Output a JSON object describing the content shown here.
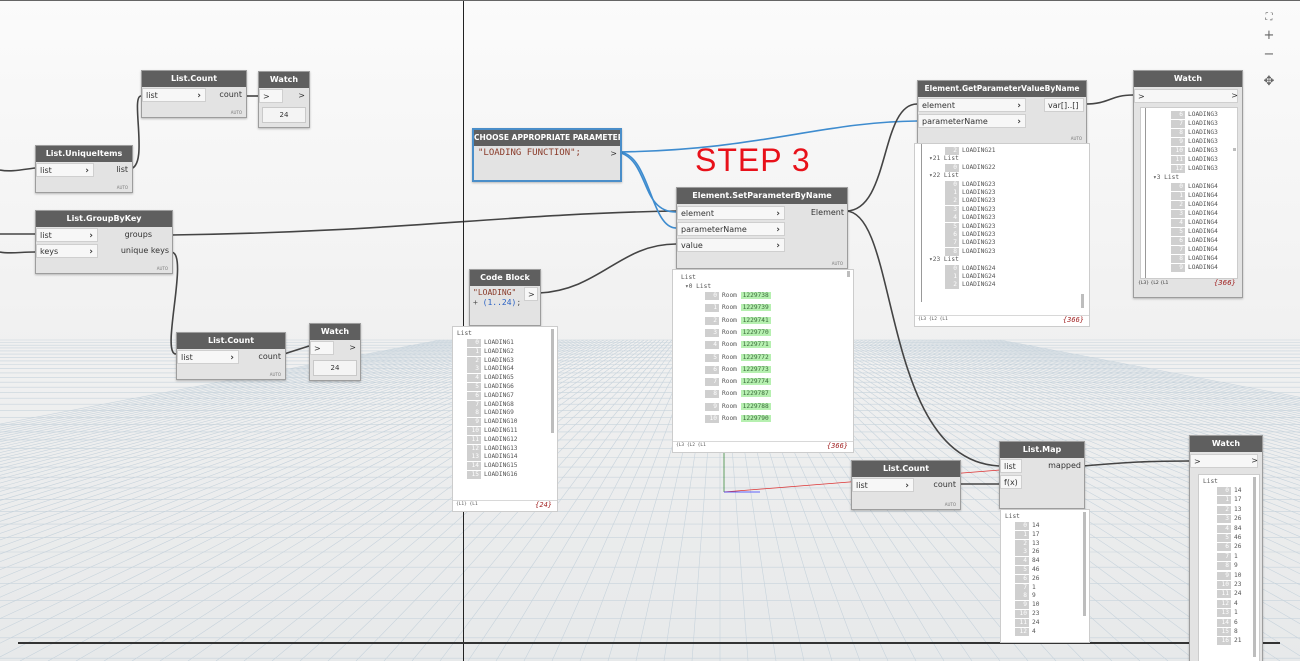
{
  "step_label": "STEP 3",
  "controls": {
    "fit": "⛶",
    "zoom_in": "+",
    "zoom_out": "−",
    "pan": "✥"
  },
  "nodes": {
    "count_top": {
      "title": "List.Count",
      "in": "list",
      "out": "count",
      "auto": "AUTO"
    },
    "watch_top": {
      "title": "Watch",
      "in": ">",
      "out": ">",
      "value": "24"
    },
    "unique": {
      "title": "List.UniqueItems",
      "in": "list",
      "out": "list",
      "auto": "AUTO"
    },
    "groupby": {
      "title": "List.GroupByKey",
      "in1": "list",
      "in2": "keys",
      "out1": "groups",
      "out2": "unique keys",
      "auto": "AUTO"
    },
    "count_mid": {
      "title": "List.Count",
      "in": "list",
      "out": "count",
      "auto": "AUTO"
    },
    "watch_mid": {
      "title": "Watch",
      "in": ">",
      "out": ">",
      "value": "24"
    },
    "choose": {
      "title": "CHOOSE APPROPRIATE PARAMETER",
      "code": "\"LOADING FUNCTION\";",
      "out": ">"
    },
    "codeblock": {
      "title": "Code Block",
      "line1": "\"LOADING\"",
      "line2a": "+ ",
      "line2b": "(1..24)",
      "line2c": ";",
      "out": ">"
    },
    "setparam": {
      "title": "Element.SetParameterByName",
      "in1": "element",
      "in2": "parameterName",
      "in3": "value",
      "out": "Element",
      "auto": "AUTO"
    },
    "getparam": {
      "title": "Element.GetParameterValueByName",
      "in1": "element",
      "in2": "parameterName",
      "out": "var[]..[]",
      "auto": "AUTO"
    },
    "watch_right": {
      "title": "Watch",
      "in": ">",
      "out": ">",
      "footer": "{L3} {L2 {L1",
      "count": "{366}"
    },
    "count_bottom": {
      "title": "List.Count",
      "in": "list",
      "out": "count",
      "auto": "AUTO"
    },
    "listmap": {
      "title": "List.Map",
      "in1": "list",
      "in2": "f(x)",
      "out": "mapped"
    },
    "watch_bottom": {
      "title": "Watch",
      "in": ">",
      "out": ">"
    }
  },
  "previews": {
    "codeblock": {
      "header": "List",
      "items": [
        {
          "i": "0",
          "v": "LOADING1"
        },
        {
          "i": "1",
          "v": "LOADING2"
        },
        {
          "i": "2",
          "v": "LOADING3"
        },
        {
          "i": "3",
          "v": "LOADING4"
        },
        {
          "i": "4",
          "v": "LOADING5"
        },
        {
          "i": "5",
          "v": "LOADING6"
        },
        {
          "i": "6",
          "v": "LOADING7"
        },
        {
          "i": "7",
          "v": "LOADING8"
        },
        {
          "i": "8",
          "v": "LOADING9"
        },
        {
          "i": "9",
          "v": "LOADING10"
        },
        {
          "i": "10",
          "v": "LOADING11"
        },
        {
          "i": "11",
          "v": "LOADING12"
        },
        {
          "i": "12",
          "v": "LOADING13"
        },
        {
          "i": "13",
          "v": "LOADING14"
        },
        {
          "i": "14",
          "v": "LOADING15"
        },
        {
          "i": "15",
          "v": "LOADING16"
        }
      ],
      "footer": "{L1} {L1",
      "count": "{24}"
    },
    "setparam": {
      "header": "List",
      "sub": "0 List",
      "label": "Room",
      "items": [
        {
          "i": "0",
          "v": "1229738"
        },
        {
          "i": "1",
          "v": "1229739"
        },
        {
          "i": "2",
          "v": "1229741"
        },
        {
          "i": "3",
          "v": "1229770"
        },
        {
          "i": "4",
          "v": "1229771"
        },
        {
          "i": "5",
          "v": "1229772"
        },
        {
          "i": "6",
          "v": "1229773"
        },
        {
          "i": "7",
          "v": "1229774"
        },
        {
          "i": "8",
          "v": "1229787"
        },
        {
          "i": "9",
          "v": "1229788"
        },
        {
          "i": "10",
          "v": "1229790"
        }
      ],
      "footer": "{L3 {L2 {L1",
      "count": "{366}"
    },
    "getparam": {
      "rows": [
        {
          "t": "idx",
          "i": "2",
          "v": "LOADING21"
        },
        {
          "t": "list",
          "v": "21 List"
        },
        {
          "t": "idx",
          "i": "0",
          "v": "LOADING22"
        },
        {
          "t": "list",
          "v": "22 List"
        },
        {
          "t": "idx",
          "i": "0",
          "v": "LOADING23"
        },
        {
          "t": "idx",
          "i": "1",
          "v": "LOADING23"
        },
        {
          "t": "idx",
          "i": "2",
          "v": "LOADING23"
        },
        {
          "t": "idx",
          "i": "3",
          "v": "LOADING23"
        },
        {
          "t": "idx",
          "i": "4",
          "v": "LOADING23"
        },
        {
          "t": "idx",
          "i": "5",
          "v": "LOADING23"
        },
        {
          "t": "idx",
          "i": "6",
          "v": "LOADING23"
        },
        {
          "t": "idx",
          "i": "7",
          "v": "LOADING23"
        },
        {
          "t": "idx",
          "i": "8",
          "v": "LOADING23"
        },
        {
          "t": "list",
          "v": "23 List"
        },
        {
          "t": "idx",
          "i": "0",
          "v": "LOADING24"
        },
        {
          "t": "idx",
          "i": "1",
          "v": "LOADING24"
        },
        {
          "t": "idx",
          "i": "2",
          "v": "LOADING24"
        }
      ],
      "footer": "{L3 {L2 {L1",
      "count": "{366}"
    },
    "watch_right": {
      "rows": [
        {
          "t": "idx",
          "i": "6",
          "v": "LOADING3"
        },
        {
          "t": "idx",
          "i": "7",
          "v": "LOADING3"
        },
        {
          "t": "idx",
          "i": "8",
          "v": "LOADING3"
        },
        {
          "t": "idx",
          "i": "9",
          "v": "LOADING3"
        },
        {
          "t": "idx",
          "i": "10",
          "v": "LOADING3"
        },
        {
          "t": "idx",
          "i": "11",
          "v": "LOADING3"
        },
        {
          "t": "idx",
          "i": "12",
          "v": "LOADING3"
        },
        {
          "t": "list",
          "v": "3 List"
        },
        {
          "t": "idx",
          "i": "0",
          "v": "LOADING4"
        },
        {
          "t": "idx",
          "i": "1",
          "v": "LOADING4"
        },
        {
          "t": "idx",
          "i": "2",
          "v": "LOADING4"
        },
        {
          "t": "idx",
          "i": "3",
          "v": "LOADING4"
        },
        {
          "t": "idx",
          "i": "4",
          "v": "LOADING4"
        },
        {
          "t": "idx",
          "i": "5",
          "v": "LOADING4"
        },
        {
          "t": "idx",
          "i": "6",
          "v": "LOADING4"
        },
        {
          "t": "idx",
          "i": "7",
          "v": "LOADING4"
        },
        {
          "t": "idx",
          "i": "8",
          "v": "LOADING4"
        },
        {
          "t": "idx",
          "i": "9",
          "v": "LOADING4"
        }
      ]
    },
    "listmap": {
      "header": "List",
      "items": [
        {
          "i": "0",
          "v": "14"
        },
        {
          "i": "1",
          "v": "17"
        },
        {
          "i": "2",
          "v": "13"
        },
        {
          "i": "3",
          "v": "26"
        },
        {
          "i": "4",
          "v": "84"
        },
        {
          "i": "5",
          "v": "46"
        },
        {
          "i": "6",
          "v": "26"
        },
        {
          "i": "7",
          "v": "1"
        },
        {
          "i": "8",
          "v": "9"
        },
        {
          "i": "9",
          "v": "10"
        },
        {
          "i": "10",
          "v": "23"
        },
        {
          "i": "11",
          "v": "24"
        },
        {
          "i": "12",
          "v": "4"
        }
      ]
    },
    "watch_bottom": {
      "header": "List",
      "items": [
        {
          "i": "0",
          "v": "14"
        },
        {
          "i": "1",
          "v": "17"
        },
        {
          "i": "2",
          "v": "13"
        },
        {
          "i": "3",
          "v": "26"
        },
        {
          "i": "4",
          "v": "84"
        },
        {
          "i": "5",
          "v": "46"
        },
        {
          "i": "6",
          "v": "26"
        },
        {
          "i": "7",
          "v": "1"
        },
        {
          "i": "8",
          "v": "9"
        },
        {
          "i": "9",
          "v": "10"
        },
        {
          "i": "10",
          "v": "23"
        },
        {
          "i": "11",
          "v": "24"
        },
        {
          "i": "12",
          "v": "4"
        },
        {
          "i": "13",
          "v": "1"
        },
        {
          "i": "14",
          "v": "6"
        },
        {
          "i": "15",
          "v": "8"
        },
        {
          "i": "16",
          "v": "21"
        }
      ]
    }
  }
}
